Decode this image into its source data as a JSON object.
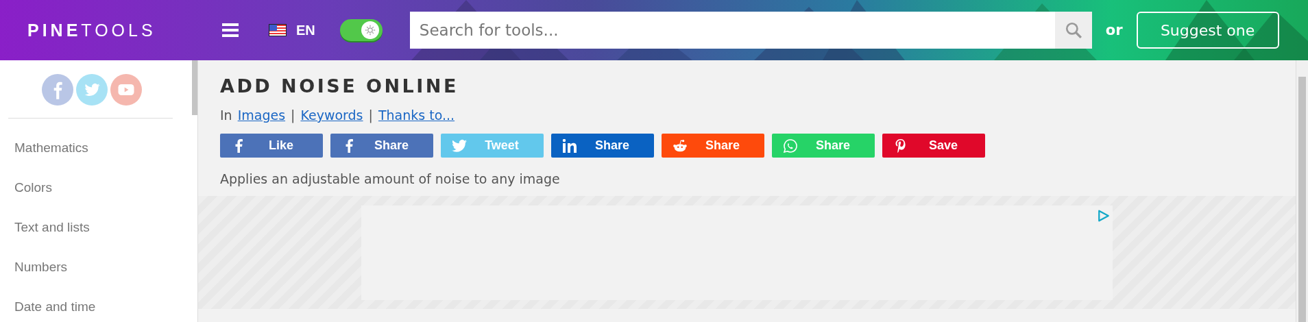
{
  "header": {
    "logo": {
      "bold": "PINE",
      "light": "TOOLS"
    },
    "language": "EN",
    "theme_toggle": {
      "on": true
    },
    "search": {
      "placeholder": "Search for tools..."
    },
    "or_text": "or",
    "suggest_button": "Suggest one"
  },
  "sidebar": {
    "categories": [
      {
        "label": "Mathematics"
      },
      {
        "label": "Colors"
      },
      {
        "label": "Text and lists"
      },
      {
        "label": "Numbers"
      },
      {
        "label": "Date and time"
      }
    ]
  },
  "main": {
    "title": "ADD NOISE ONLINE",
    "breadcrumb": {
      "prefix": "In",
      "separators": [
        "|",
        "|"
      ],
      "links": [
        "Images",
        "Keywords",
        "Thanks to..."
      ]
    },
    "share_buttons": [
      {
        "kind": "facebook",
        "label": "Like",
        "color": "#4c72b8"
      },
      {
        "kind": "facebook",
        "label": "Share",
        "color": "#4c72b8"
      },
      {
        "kind": "twitter",
        "label": "Tweet",
        "color": "#62c8ec"
      },
      {
        "kind": "linkedin",
        "label": "Share",
        "color": "#0a62c2"
      },
      {
        "kind": "reddit",
        "label": "Share",
        "color": "#fe4a0c"
      },
      {
        "kind": "whatsapp",
        "label": "Share",
        "color": "#26d367"
      },
      {
        "kind": "pinterest",
        "label": "Save",
        "color": "#e0082a"
      }
    ],
    "description": "Applies an adjustable amount of noise to any image"
  }
}
